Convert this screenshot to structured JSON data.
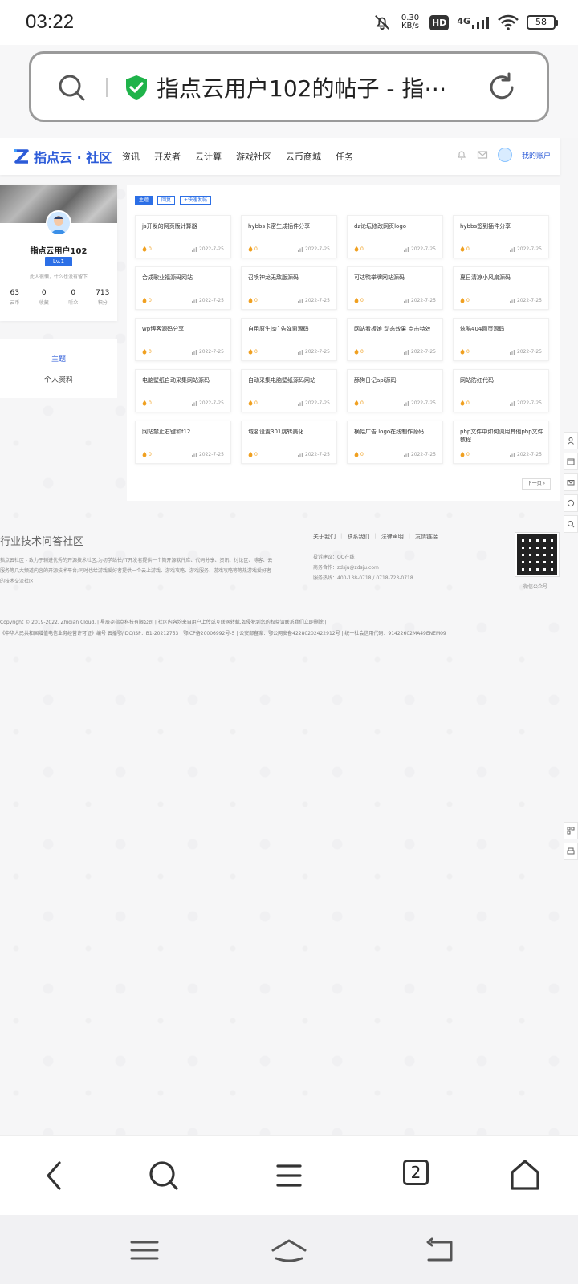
{
  "status_bar": {
    "time": "03:22",
    "net_speed_value": "0.30",
    "net_speed_unit": "KB/s",
    "hd": "HD",
    "network": "4G",
    "battery": "58",
    "icons": [
      "mute-bell-icon",
      "signal-icon",
      "wifi-icon",
      "battery-icon"
    ]
  },
  "address_bar": {
    "title": "指点云用户102的帖子 - 指⋯",
    "icons": [
      "search-icon",
      "shield-check-icon",
      "reload-icon"
    ],
    "accent": "#1fb34a"
  },
  "site": {
    "logo_text": "指点云 · 社区",
    "brand_color": "#2c5bd8",
    "nav": [
      "资讯",
      "开发者",
      "云计算",
      "游戏社区",
      "云币商城",
      "任务"
    ],
    "account_label": "我的账户"
  },
  "profile": {
    "name": "指点云用户102",
    "level": "Lv.1",
    "signature": "此人很懒，什么也没有留下",
    "stats": [
      {
        "value": "63",
        "label": "云币"
      },
      {
        "value": "0",
        "label": "收藏"
      },
      {
        "value": "0",
        "label": "听众"
      },
      {
        "value": "713",
        "label": "积分"
      }
    ]
  },
  "profile_menu": {
    "active": "主题",
    "other": "个人资料"
  },
  "tabs": [
    "主题",
    "回复",
    "+快速发帖"
  ],
  "posts": [
    {
      "title": "js开发的网页版计算器",
      "likes": "0",
      "date": "2022-7-25"
    },
    {
      "title": "hybbs卡密生成插件分享",
      "likes": "0",
      "date": "2022-7-25"
    },
    {
      "title": "dz论坛修改网页logo",
      "likes": "0",
      "date": "2022-7-25"
    },
    {
      "title": "hybbs签到插件分享",
      "likes": "0",
      "date": "2022-7-25"
    },
    {
      "title": "合成歌业福源码网站",
      "likes": "0",
      "date": "2022-7-25"
    },
    {
      "title": "召唤神龙无敌版源码",
      "likes": "0",
      "date": "2022-7-25"
    },
    {
      "title": "可达鸭举牌网站源码",
      "likes": "0",
      "date": "2022-7-25"
    },
    {
      "title": "夏日清凉小风扇源码",
      "likes": "0",
      "date": "2022-7-25"
    },
    {
      "title": "wp博客源码分享",
      "likes": "0",
      "date": "2022-7-25"
    },
    {
      "title": "自用原生js广告弹窗源码",
      "likes": "0",
      "date": "2022-7-25"
    },
    {
      "title": "网站看板娘 动态效果 点击特效",
      "likes": "0",
      "date": "2022-7-25"
    },
    {
      "title": "炫酷404网页源码",
      "likes": "0",
      "date": "2022-7-25"
    },
    {
      "title": "电脑壁纸自动采集网站源码",
      "likes": "0",
      "date": "2022-7-25"
    },
    {
      "title": "自动采集电脑壁纸源码网站",
      "likes": "0",
      "date": "2022-7-25"
    },
    {
      "title": "舔狗日记api源码",
      "likes": "0",
      "date": "2022-7-25"
    },
    {
      "title": "网站防红代码",
      "likes": "0",
      "date": "2022-7-25"
    },
    {
      "title": "网站禁止右键和f12",
      "likes": "0",
      "date": "2022-7-25"
    },
    {
      "title": "域名设置301跳转美化",
      "likes": "0",
      "date": "2022-7-25"
    },
    {
      "title": "横幅广告 logo在线制作源码",
      "likes": "0",
      "date": "2022-7-25"
    },
    {
      "title": "php文件中如何调用其他php文件教程",
      "likes": "0",
      "date": "2022-7-25"
    }
  ],
  "next_page": "下一页 ›",
  "footer": {
    "title": "行业技术问答社区",
    "description": "指点云社区 - 致力于辅进优秀的开源技术社区,为初学站长/IT开发者提供一个简开源软件库、代码分享、资讯、讨论区、博客、云服务等几大频道内容的开源技术平台;同时也给游戏爱好者提供一个云上游戏、游戏攻略、游戏服务、游戏攻略等等热游戏爱好者的技术交流社区",
    "links": [
      "关于我们",
      "联系我们",
      "法律声明",
      "友情链接"
    ],
    "contact": [
      "投诉建议：QQ在线",
      "商务合作：zdsju@zdsju.com",
      "服务热线：400-138-0718 / 0718-723-0718"
    ],
    "qr_label": "微信公众号",
    "copyright": "Copyright © 2019-2022, Zhidian Cloud.  |  星辰尧指点科技有限公司  |  社区内容均来自用户上传或互联网转载,如侵犯到您的权益请联系我们立即删除  |",
    "license": "《中华人民共和国增值电信业务经营许可证》编号 云播鄂/IDC/ISP：B1-20212753  |  鄂ICP备20006992号-5  |  公安部备案：鄂公网安备42280202422912号  |  统一社会信用代码：91422602MA49ENEM09"
  },
  "browser_toolbar": {
    "tabs_count": "2",
    "icons": [
      "back-icon",
      "search-icon",
      "menu-icon",
      "tabs-icon",
      "home-icon"
    ]
  },
  "system_nav": {
    "icons": [
      "recents-icon",
      "home-icon",
      "back-icon"
    ]
  }
}
